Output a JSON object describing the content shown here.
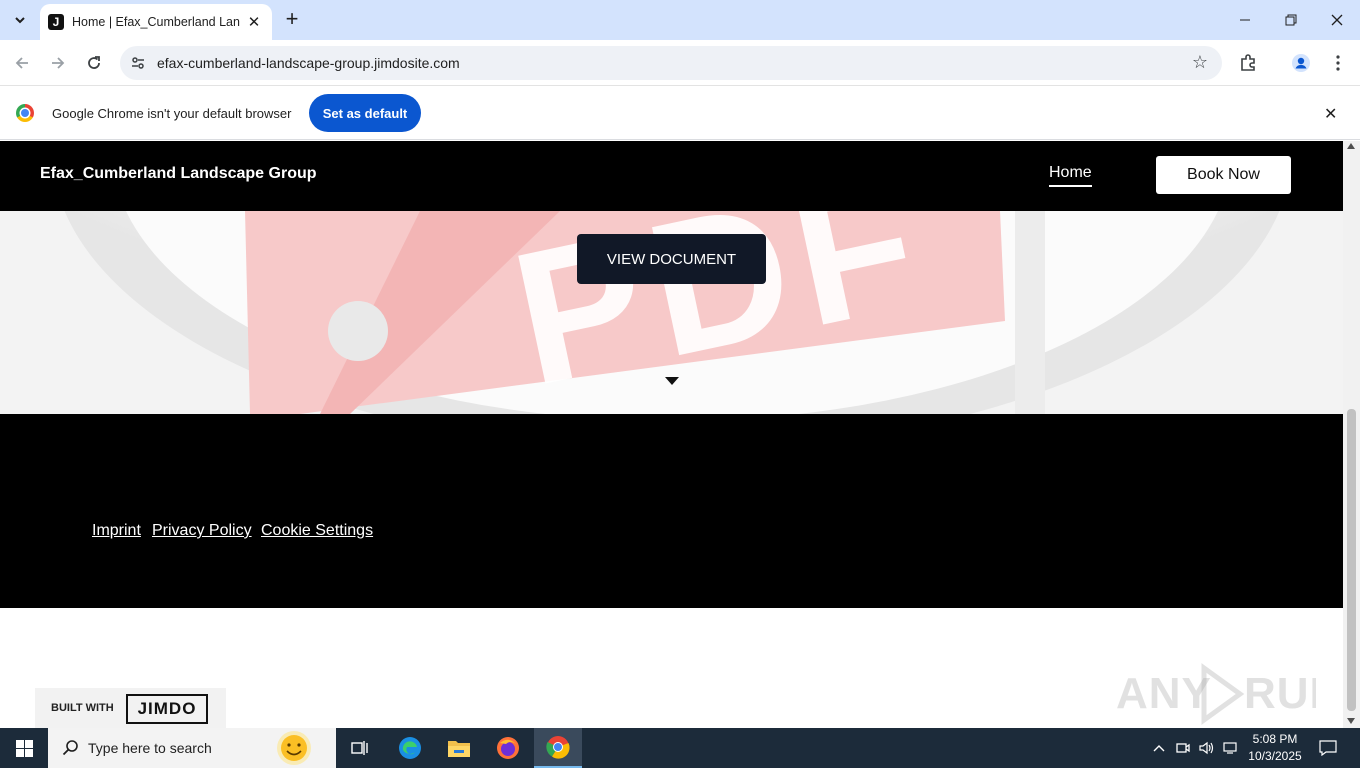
{
  "browser": {
    "tab_title": "Home | Efax_Cumberland Landscape Group",
    "tab_favicon_letter": "J",
    "url": "efax-cumberland-landscape-group.jimdosite.com",
    "new_tab_label": "+",
    "controls": {
      "minimize": "—",
      "restore": "❐",
      "close": "✕"
    }
  },
  "infobar": {
    "message": "Google Chrome isn't your default browser",
    "set_default_label": "Set as default",
    "close_label": "✕"
  },
  "site": {
    "title": "Efax_Cumberland Landscape Group",
    "nav_home": "Home",
    "book_now": "Book Now",
    "hero_watermark": "PDF",
    "view_document": "VIEW DOCUMENT",
    "footer_links": [
      "Imprint",
      "Privacy Policy",
      "Cookie Settings"
    ],
    "built_with": "BUILT WITH",
    "jimdo_logo": "JIMDO"
  },
  "watermark": "ANY.RUN",
  "taskbar": {
    "search_placeholder": "Type here to search",
    "time": "5:08 PM",
    "date": "10/3/2025"
  },
  "colors": {
    "tabstrip": "#d3e3fd",
    "accent_blue": "#0b57d0",
    "site_black": "#000000",
    "view_button": "#111827",
    "taskbar": "#1c2b3a"
  }
}
